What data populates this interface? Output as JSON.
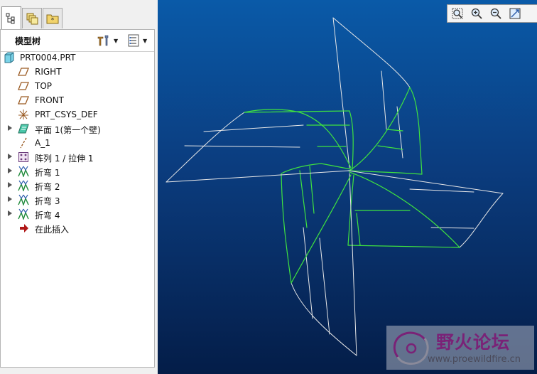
{
  "tabs": [
    {
      "icon": "model-tree-icon",
      "active": true
    },
    {
      "icon": "layers-icon",
      "active": false
    },
    {
      "icon": "folder-star-icon",
      "active": false
    }
  ],
  "model_tree": {
    "title": "模型树",
    "tools_icon": "tree-tools-icon",
    "filter_icon": "tree-filter-icon",
    "items": [
      {
        "label": "PRT0004.PRT",
        "icon": "part-icon",
        "expandable": false
      },
      {
        "label": "RIGHT",
        "icon": "datum-plane-icon",
        "expandable": false
      },
      {
        "label": "TOP",
        "icon": "datum-plane-icon",
        "expandable": false
      },
      {
        "label": "FRONT",
        "icon": "datum-plane-icon",
        "expandable": false
      },
      {
        "label": "PRT_CSYS_DEF",
        "icon": "csys-icon",
        "expandable": false
      },
      {
        "label": "平面 1(第一个壁)",
        "icon": "flat-wall-icon",
        "expandable": true
      },
      {
        "label": "A_1",
        "icon": "datum-axis-icon",
        "expandable": false
      },
      {
        "label": "阵列 1 / 拉伸 1",
        "icon": "pattern-icon",
        "expandable": true
      },
      {
        "label": "折弯 1",
        "icon": "bend-icon",
        "expandable": true
      },
      {
        "label": "折弯 2",
        "icon": "bend-icon",
        "expandable": true
      },
      {
        "label": "折弯 3",
        "icon": "bend-icon",
        "expandable": true
      },
      {
        "label": "折弯 4",
        "icon": "bend-icon",
        "expandable": true
      },
      {
        "label": "在此插入",
        "icon": "insert-here-arrow-icon",
        "expandable": false
      }
    ]
  },
  "view_toolbar": [
    {
      "icon": "zoom-window-icon"
    },
    {
      "icon": "zoom-in-icon"
    },
    {
      "icon": "zoom-out-icon"
    },
    {
      "icon": "refit-icon"
    }
  ],
  "watermark": {
    "title": "野火论坛",
    "url": "www.proewildfire.cn"
  },
  "colors": {
    "viewport_top": "#0a5aa8",
    "viewport_bottom": "#041d48",
    "edge_white": "#e8e8e8",
    "edge_green": "#3fe33f",
    "watermark_title": "#7a2277"
  }
}
